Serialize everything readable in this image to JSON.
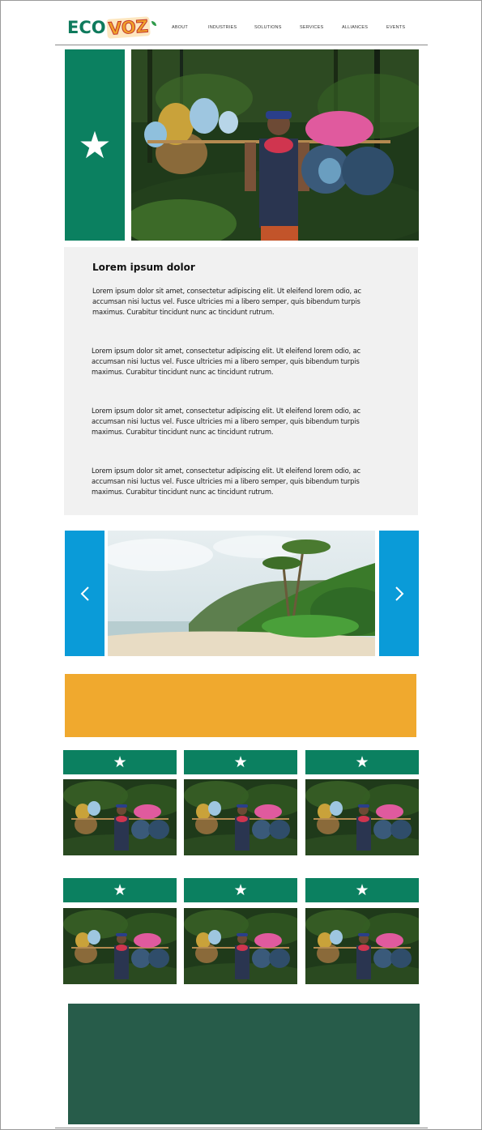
{
  "brand": {
    "logo_left": "ECO",
    "logo_right": "VOZ"
  },
  "nav": [
    "ABOUT",
    "INDUSTRIES",
    "SOLUTIONS",
    "SERVICES",
    "ALLIANCES",
    "EVENTS"
  ],
  "hero": {
    "icon": "star-icon"
  },
  "content": {
    "heading": "Lorem ipsum dolor",
    "paragraphs": [
      "Lorem ipsum dolor sit amet, consectetur adipiscing elit. Ut eleifend lorem odio, ac accumsan nisi luctus vel. Fusce ultricies mi a libero semper, quis bibendum turpis maximus. Curabitur tincidunt nunc ac tincidunt rutrum.",
      "Lorem ipsum dolor sit amet, consectetur adipiscing elit. Ut eleifend lorem odio, ac accumsan nisi luctus vel. Fusce ultricies mi a libero semper, quis bibendum turpis maximus. Curabitur tincidunt nunc ac tincidunt rutrum.",
      "Lorem ipsum dolor sit amet, consectetur adipiscing elit. Ut eleifend lorem odio, ac accumsan nisi luctus vel. Fusce ultricies mi a libero semper, quis bibendum turpis maximus. Curabitur tincidunt nunc ac tincidunt rutrum.",
      "Lorem ipsum dolor sit amet, consectetur adipiscing elit. Ut eleifend lorem odio, ac accumsan nisi luctus vel. Fusce ultricies mi a libero semper, quis bibendum turpis maximus. Curabitur tincidunt nunc ac tincidunt rutrum."
    ]
  },
  "carousel": {
    "prev_icon": "chevron-left-icon",
    "next_icon": "chevron-right-icon"
  },
  "colors": {
    "green": "#0b8060",
    "blue": "#0a9bd8",
    "orange": "#f0a92e",
    "dark_green": "#275c4a",
    "panel": "#f1f1f1"
  }
}
